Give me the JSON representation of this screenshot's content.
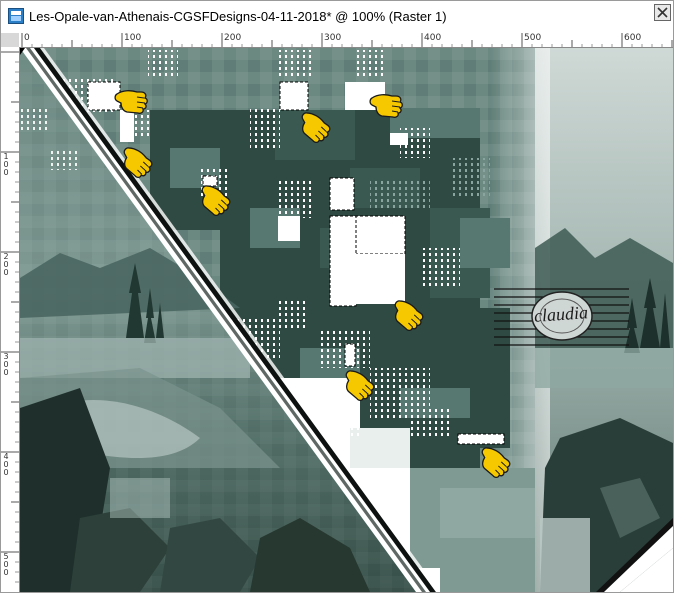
{
  "window": {
    "title": "Les-Opale-van-Athenais-CGSFDesigns-04-11-2018* @ 100% (Raster 1)"
  },
  "rulers": {
    "top_labels": [
      "0",
      "100",
      "200",
      "300",
      "400",
      "500",
      "600"
    ],
    "left_labels": [
      "1\n0\n0",
      "2\n0\n0",
      "3\n0\n0",
      "4\n0\n0",
      "5\n0\n0"
    ]
  },
  "watermark": {
    "text": "claudia"
  },
  "icons": {
    "app": "paint-shop-pro-icon",
    "close": "close-icon",
    "pointer": "pointing-hand-icon"
  },
  "colors": {
    "canvas_teal": "#5d7c75",
    "dark_teal": "#2f4a42",
    "selection_white": "#ffffff",
    "pointer_yellow": "#f5c800"
  }
}
